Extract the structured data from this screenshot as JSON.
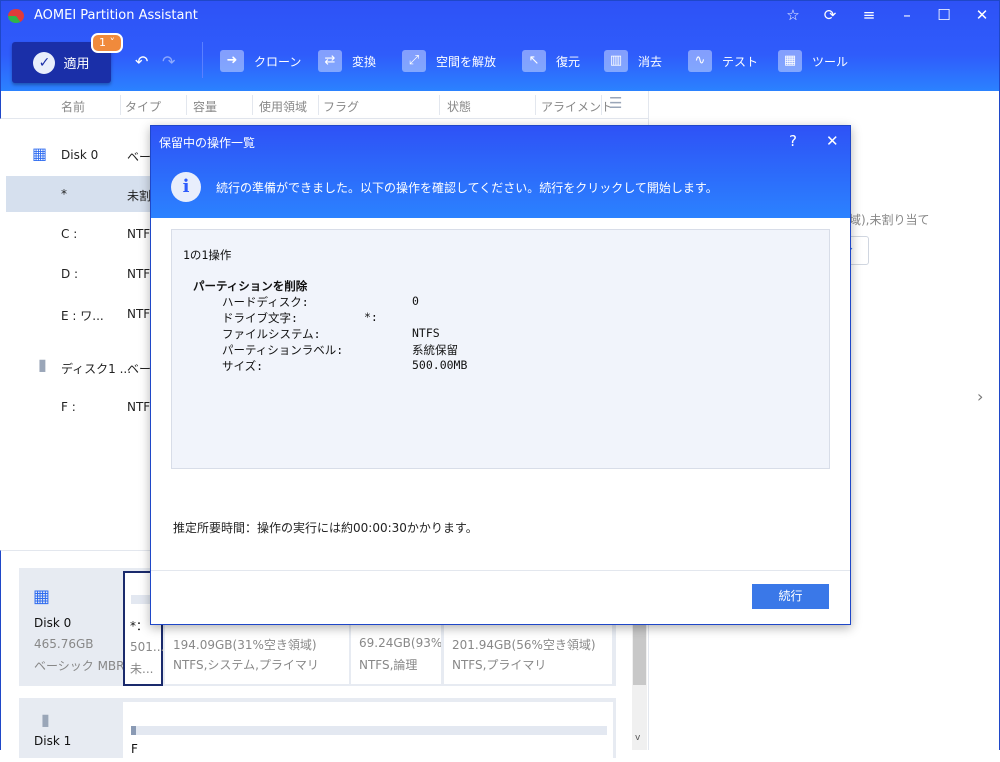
{
  "app": {
    "title": "AOMEI Partition Assistant"
  },
  "toolbar": {
    "apply": "適用",
    "badge": "1",
    "tools": [
      "クローン",
      "変換",
      "空間を解放",
      "復元",
      "消去",
      "テスト",
      "ツール"
    ]
  },
  "columns": [
    "名前",
    "タイプ",
    "容量",
    "使用領域",
    "フラグ",
    "状態",
    "アライメント"
  ],
  "rows": [
    {
      "name": "Disk 0",
      "type": "ベーシ"
    },
    {
      "name": "*",
      "type": "未割"
    },
    {
      "name": "C :",
      "type": "NTFS"
    },
    {
      "name": "D :",
      "type": "NTFS"
    },
    {
      "name": "E : ワ...",
      "type": "NTFS"
    },
    {
      "name": "ディスク1 ...",
      "type": "ベーシ"
    },
    {
      "name": "F :",
      "type": "NTFS"
    }
  ],
  "right_panel": {
    "text": "域),未割り当て",
    "button": "イ"
  },
  "disk0": {
    "name": "Disk 0",
    "size": "465.76GB",
    "type": "ベーシック MBR",
    "parts": [
      {
        "label": "*：",
        "size": "501....",
        "info": "未..."
      },
      {
        "size": "194.09GB(31%空き領域)",
        "info": "NTFS,システム,プライマリ"
      },
      {
        "size": "69.24GB(93%...",
        "info": "NTFS,論理"
      },
      {
        "size": "201.94GB(56%空き領域)",
        "info": "NTFS,プライマリ"
      }
    ]
  },
  "disk1": {
    "name": "Disk 1",
    "part_label": "F"
  },
  "dialog": {
    "title": "保留中の操作一覧",
    "message": "続行の準備ができました。以下の操作を確認してください。続行をクリックして開始します。",
    "count": "1の1操作",
    "op_title": "パーティションを削除",
    "details": [
      {
        "k": "ハードディスク:",
        "v": "0"
      },
      {
        "k": "ドライブ文字:",
        "v": "*:"
      },
      {
        "k": "ファイルシステム:",
        "v": "NTFS"
      },
      {
        "k": "パーティションラベル:",
        "v": "系統保留"
      },
      {
        "k": "サイズ:",
        "v": "500.00MB"
      }
    ],
    "estimate": "推定所要時間：操作の実行には約00:00:30かかります。",
    "continue": "続行"
  }
}
